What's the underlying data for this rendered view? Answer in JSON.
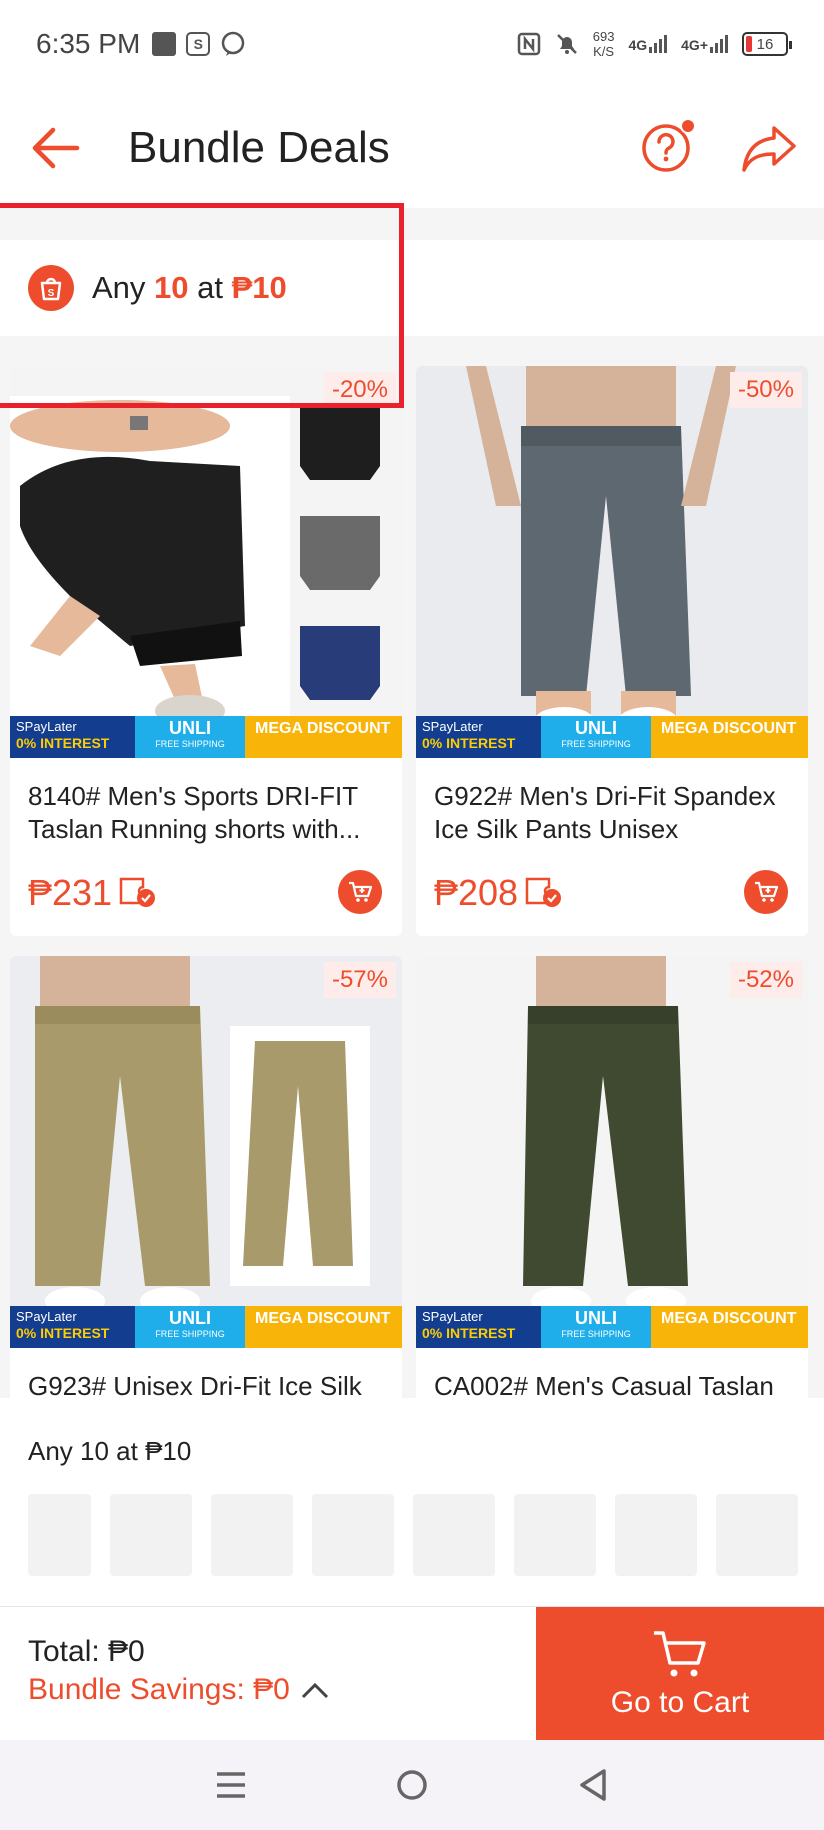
{
  "status_bar": {
    "time": "6:35 PM",
    "net_speed": "693",
    "net_speed_unit": "K/S",
    "sim1": "4G",
    "sim2": "4G+",
    "battery": "16"
  },
  "header": {
    "title": "Bundle Deals"
  },
  "banner": {
    "prefix": "Any ",
    "qty": "10",
    "mid": " at ",
    "price": "₱10"
  },
  "promo": {
    "spay_top": "SPayLater",
    "spay_bottom": "0% INTEREST",
    "unli": "UNLI",
    "unli_sub": "FREE SHIPPING",
    "mega": "MEGA DISCOUNT"
  },
  "products": [
    {
      "title": "8140# Men's Sports DRI-FIT Taslan Running shorts with...",
      "price": "₱231",
      "discount": "-20%"
    },
    {
      "title": "G922# Men's Dri-Fit Spandex Ice Silk Pants Unisex",
      "price": "₱208",
      "discount": "-50%"
    },
    {
      "title": "G923# Unisex Dri-Fit Ice Silk",
      "price": "",
      "discount": "-57%"
    },
    {
      "title": "CA002# Men's Casual Taslan",
      "price": "",
      "discount": "-52%"
    }
  ],
  "tray": {
    "label": "Any 10 at ₱10"
  },
  "bottom": {
    "total": "Total: ₱0",
    "savings": "Bundle Savings: ₱0",
    "go_to_cart": "Go to Cart"
  },
  "colors": {
    "accent": "#ee4d2d",
    "highlight_box": "#e8212d"
  }
}
